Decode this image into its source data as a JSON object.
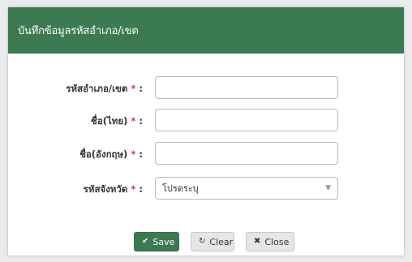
{
  "modal": {
    "title": "บันทึกข้อมูลรหัสอำเภอ/เขต"
  },
  "form": {
    "fields": [
      {
        "label": "รหัสอำเภอ/เขต",
        "required_mark": "*",
        "colon": ":",
        "value": ""
      },
      {
        "label": "ชื่อ(ไทย)",
        "required_mark": "*",
        "colon": ":",
        "value": ""
      },
      {
        "label": "ชื่อ(อังกฤษ)",
        "required_mark": "*",
        "colon": ":",
        "value": ""
      },
      {
        "label": "รหัสจังหวัด",
        "required_mark": "*",
        "colon": ":",
        "selected": "โปรดระบุ"
      }
    ]
  },
  "buttons": {
    "save": {
      "label": "Save",
      "icon": "check-icon"
    },
    "clear": {
      "label": "Clear",
      "icon": "refresh-icon"
    },
    "close": {
      "label": "Close",
      "icon": "x-icon"
    }
  },
  "colors": {
    "header_bg": "#3c7a52",
    "save_bg": "#3c7a52",
    "required": "#e53935"
  }
}
